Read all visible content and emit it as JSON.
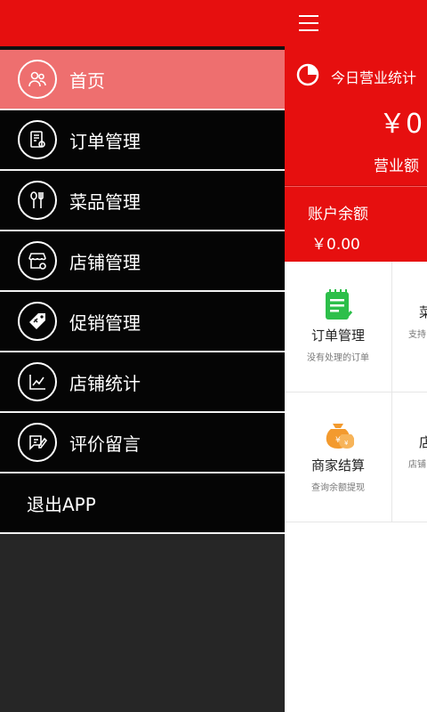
{
  "drawer": {
    "items": [
      {
        "label": "首页",
        "icon": "users-icon",
        "active": true
      },
      {
        "label": "订单管理",
        "icon": "order-doc-icon"
      },
      {
        "label": "菜品管理",
        "icon": "utensils-icon"
      },
      {
        "label": "店铺管理",
        "icon": "store-icon"
      },
      {
        "label": "促销管理",
        "icon": "tag-icon"
      },
      {
        "label": "店铺统计",
        "icon": "line-chart-icon"
      },
      {
        "label": "评价留言",
        "icon": "comment-edit-icon"
      }
    ],
    "logout_label": "退出APP"
  },
  "main": {
    "stats_title": "今日营业统计",
    "stats_value": "￥0",
    "stats_label": "营业额",
    "balance_label": "账户余额",
    "balance_value": "￥0.00",
    "grid": [
      {
        "title": "订单管理",
        "sub": "没有处理的订单"
      },
      {
        "title": "菜",
        "sub": "支持"
      },
      {
        "title": "商家结算",
        "sub": "查询余额提现"
      },
      {
        "title": "店",
        "sub": "店铺"
      }
    ]
  },
  "colors": {
    "brand_red": "#e60f0f",
    "active_pink": "#ee6f6f",
    "icon_green": "#2dbf4a",
    "icon_orange": "#f39a2e"
  }
}
